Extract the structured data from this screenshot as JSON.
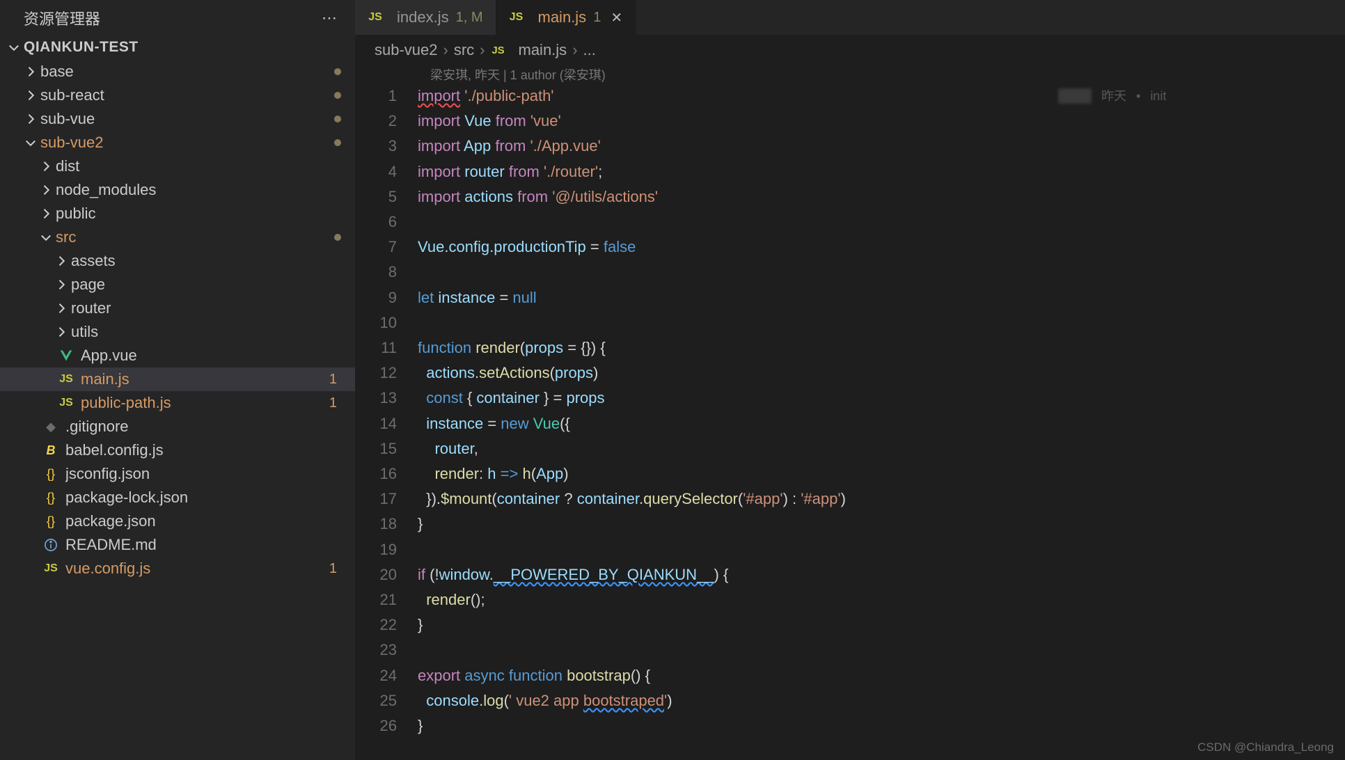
{
  "sidebar": {
    "title": "资源管理器",
    "root": "QIANKUN-TEST",
    "tree": [
      {
        "name": "base",
        "kind": "folder",
        "indent": 1,
        "chev": "right",
        "modified": true
      },
      {
        "name": "sub-react",
        "kind": "folder",
        "indent": 1,
        "chev": "right",
        "modified": true
      },
      {
        "name": "sub-vue",
        "kind": "folder",
        "indent": 1,
        "chev": "right",
        "modified": true
      },
      {
        "name": "sub-vue2",
        "kind": "folder",
        "indent": 1,
        "chev": "down",
        "modified": true,
        "color": "orange"
      },
      {
        "name": "dist",
        "kind": "folder",
        "indent": 2,
        "chev": "right"
      },
      {
        "name": "node_modules",
        "kind": "folder",
        "indent": 2,
        "chev": "right"
      },
      {
        "name": "public",
        "kind": "folder",
        "indent": 2,
        "chev": "right"
      },
      {
        "name": "src",
        "kind": "folder",
        "indent": 2,
        "chev": "down",
        "modified": true,
        "color": "orange"
      },
      {
        "name": "assets",
        "kind": "folder",
        "indent": 3,
        "chev": "right"
      },
      {
        "name": "page",
        "kind": "folder",
        "indent": 3,
        "chev": "right"
      },
      {
        "name": "router",
        "kind": "folder",
        "indent": 3,
        "chev": "right"
      },
      {
        "name": "utils",
        "kind": "folder",
        "indent": 3,
        "chev": "right"
      },
      {
        "name": "App.vue",
        "kind": "vue",
        "indent": 3
      },
      {
        "name": "main.js",
        "kind": "js",
        "indent": 3,
        "badge": "1",
        "color": "orange",
        "selected": true
      },
      {
        "name": "public-path.js",
        "kind": "js",
        "indent": 3,
        "badge": "1",
        "color": "orange"
      },
      {
        "name": ".gitignore",
        "kind": "gitignore",
        "indent": 2
      },
      {
        "name": "babel.config.js",
        "kind": "babel",
        "indent": 2
      },
      {
        "name": "jsconfig.json",
        "kind": "json",
        "indent": 2
      },
      {
        "name": "package-lock.json",
        "kind": "json",
        "indent": 2
      },
      {
        "name": "package.json",
        "kind": "json",
        "indent": 2
      },
      {
        "name": "README.md",
        "kind": "readme",
        "indent": 2
      },
      {
        "name": "vue.config.js",
        "kind": "js",
        "indent": 2,
        "badge": "1",
        "color": "orange"
      }
    ]
  },
  "tabs": [
    {
      "icon": "js",
      "name": "index.js",
      "tag": "1, M",
      "active": false
    },
    {
      "icon": "js",
      "name": "main.js",
      "tag": "1",
      "active": true,
      "close": true
    }
  ],
  "breadcrumb": {
    "parts": [
      "sub-vue2",
      "src",
      "main.js",
      "..."
    ],
    "fileIcon": "js"
  },
  "authorLine": "梁安琪, 昨天 | 1 author (梁安琪)",
  "blame": {
    "time": "昨天",
    "sep": "•",
    "msg": "init"
  },
  "code": [
    {
      "n": 1,
      "seg": [
        [
          "k1 err-u",
          "import"
        ],
        [
          "op",
          " "
        ],
        [
          "str",
          "'./public-path'"
        ]
      ],
      "blame": true
    },
    {
      "n": 2,
      "seg": [
        [
          "k1",
          "import"
        ],
        [
          "op",
          " "
        ],
        [
          "var",
          "Vue"
        ],
        [
          "op",
          " "
        ],
        [
          "k1",
          "from"
        ],
        [
          "op",
          " "
        ],
        [
          "str",
          "'vue'"
        ]
      ]
    },
    {
      "n": 3,
      "seg": [
        [
          "k1",
          "import"
        ],
        [
          "op",
          " "
        ],
        [
          "var",
          "App"
        ],
        [
          "op",
          " "
        ],
        [
          "k1",
          "from"
        ],
        [
          "op",
          " "
        ],
        [
          "str",
          "'./App.vue'"
        ]
      ]
    },
    {
      "n": 4,
      "seg": [
        [
          "k1",
          "import"
        ],
        [
          "op",
          " "
        ],
        [
          "var",
          "router"
        ],
        [
          "op",
          " "
        ],
        [
          "k1",
          "from"
        ],
        [
          "op",
          " "
        ],
        [
          "str",
          "'./router'"
        ],
        [
          "op",
          ";"
        ]
      ]
    },
    {
      "n": 5,
      "seg": [
        [
          "k1",
          "import"
        ],
        [
          "op",
          " "
        ],
        [
          "var",
          "actions"
        ],
        [
          "op",
          " "
        ],
        [
          "k1",
          "from"
        ],
        [
          "op",
          " "
        ],
        [
          "str",
          "'@/utils/actions'"
        ]
      ]
    },
    {
      "n": 6,
      "seg": []
    },
    {
      "n": 7,
      "seg": [
        [
          "var",
          "Vue"
        ],
        [
          "op",
          "."
        ],
        [
          "var",
          "config"
        ],
        [
          "op",
          "."
        ],
        [
          "var",
          "productionTip"
        ],
        [
          "op",
          " = "
        ],
        [
          "k2",
          "false"
        ]
      ]
    },
    {
      "n": 8,
      "seg": []
    },
    {
      "n": 9,
      "seg": [
        [
          "k2",
          "let"
        ],
        [
          "op",
          " "
        ],
        [
          "var",
          "instance"
        ],
        [
          "op",
          " = "
        ],
        [
          "k2",
          "null"
        ]
      ]
    },
    {
      "n": 10,
      "seg": []
    },
    {
      "n": 11,
      "seg": [
        [
          "k2",
          "function"
        ],
        [
          "op",
          " "
        ],
        [
          "fn",
          "render"
        ],
        [
          "op",
          "("
        ],
        [
          "var",
          "props"
        ],
        [
          "op",
          " = {}) {"
        ]
      ]
    },
    {
      "n": 12,
      "seg": [
        [
          "op",
          "  "
        ],
        [
          "var",
          "actions"
        ],
        [
          "op",
          "."
        ],
        [
          "fn",
          "setActions"
        ],
        [
          "op",
          "("
        ],
        [
          "var",
          "props"
        ],
        [
          "op",
          ")"
        ]
      ]
    },
    {
      "n": 13,
      "seg": [
        [
          "op",
          "  "
        ],
        [
          "k2",
          "const"
        ],
        [
          "op",
          " { "
        ],
        [
          "var",
          "container"
        ],
        [
          "op",
          " } = "
        ],
        [
          "var",
          "props"
        ]
      ]
    },
    {
      "n": 14,
      "seg": [
        [
          "op",
          "  "
        ],
        [
          "var",
          "instance"
        ],
        [
          "op",
          " = "
        ],
        [
          "k2",
          "new"
        ],
        [
          "op",
          " "
        ],
        [
          "cls",
          "Vue"
        ],
        [
          "op",
          "({"
        ]
      ]
    },
    {
      "n": 15,
      "seg": [
        [
          "op",
          "    "
        ],
        [
          "var",
          "router"
        ],
        [
          "op",
          ","
        ]
      ]
    },
    {
      "n": 16,
      "seg": [
        [
          "op",
          "    "
        ],
        [
          "fn",
          "render"
        ],
        [
          "op",
          ": "
        ],
        [
          "var",
          "h"
        ],
        [
          "op",
          " "
        ],
        [
          "k2",
          "=>"
        ],
        [
          "op",
          " "
        ],
        [
          "fn",
          "h"
        ],
        [
          "op",
          "("
        ],
        [
          "var",
          "App"
        ],
        [
          "op",
          ")"
        ]
      ]
    },
    {
      "n": 17,
      "seg": [
        [
          "op",
          "  })."
        ],
        [
          "fn",
          "$mount"
        ],
        [
          "op",
          "("
        ],
        [
          "var",
          "container"
        ],
        [
          "op",
          " ? "
        ],
        [
          "var",
          "container"
        ],
        [
          "op",
          "."
        ],
        [
          "fn",
          "querySelector"
        ],
        [
          "op",
          "("
        ],
        [
          "str",
          "'#app'"
        ],
        [
          "op",
          ") : "
        ],
        [
          "str",
          "'#app'"
        ],
        [
          "op",
          ")"
        ]
      ]
    },
    {
      "n": 18,
      "seg": [
        [
          "op",
          "}"
        ]
      ]
    },
    {
      "n": 19,
      "seg": []
    },
    {
      "n": 20,
      "seg": [
        [
          "k1",
          "if"
        ],
        [
          "op",
          " (!"
        ],
        [
          "var",
          "window"
        ],
        [
          "op",
          "."
        ],
        [
          "var warn-u",
          "__POWERED_BY_QIANKUN__"
        ],
        [
          "op",
          ") {"
        ]
      ]
    },
    {
      "n": 21,
      "seg": [
        [
          "op",
          "  "
        ],
        [
          "fn",
          "render"
        ],
        [
          "op",
          "();"
        ]
      ]
    },
    {
      "n": 22,
      "seg": [
        [
          "op",
          "}"
        ]
      ]
    },
    {
      "n": 23,
      "seg": []
    },
    {
      "n": 24,
      "seg": [
        [
          "k1",
          "export"
        ],
        [
          "op",
          " "
        ],
        [
          "k2",
          "async"
        ],
        [
          "op",
          " "
        ],
        [
          "k2",
          "function"
        ],
        [
          "op",
          " "
        ],
        [
          "fn",
          "bootstrap"
        ],
        [
          "op",
          "() {"
        ]
      ]
    },
    {
      "n": 25,
      "seg": [
        [
          "op",
          "  "
        ],
        [
          "var",
          "console"
        ],
        [
          "op",
          "."
        ],
        [
          "fn",
          "log"
        ],
        [
          "op",
          "("
        ],
        [
          "str",
          "' vue2 app "
        ],
        [
          "str warn-u",
          "bootstraped"
        ],
        [
          "str",
          "'"
        ],
        [
          "op",
          ")"
        ]
      ]
    },
    {
      "n": 26,
      "seg": [
        [
          "op",
          "}"
        ]
      ]
    }
  ],
  "watermark": "CSDN @Chiandra_Leong"
}
